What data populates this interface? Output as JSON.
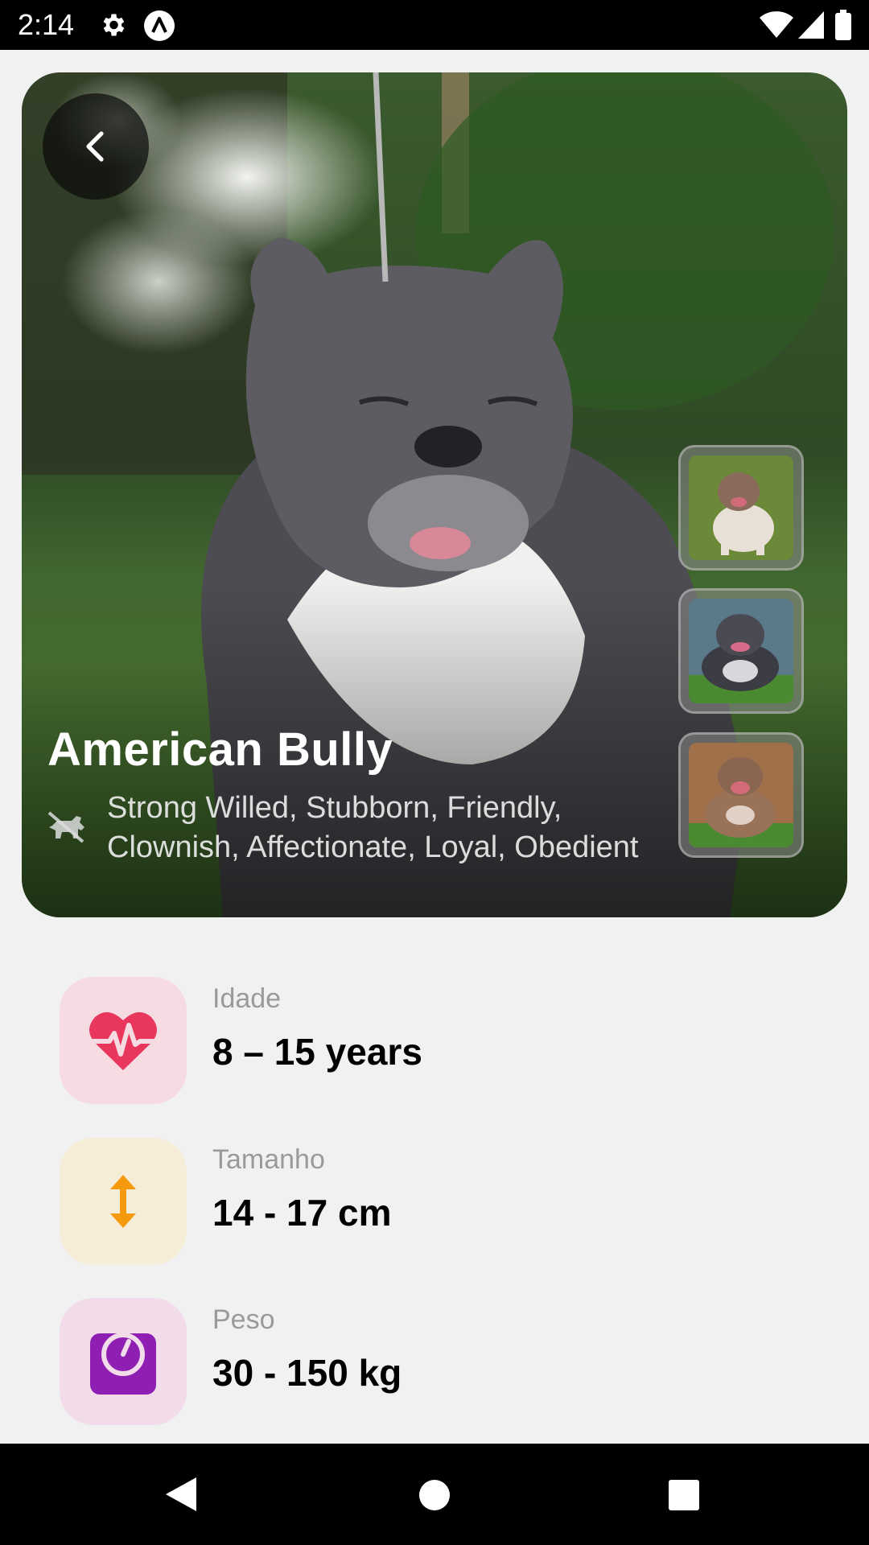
{
  "status_bar": {
    "time": "2:14",
    "icons": [
      "gear-icon",
      "app-a-icon",
      "wifi-icon",
      "signal-icon",
      "battery-icon"
    ]
  },
  "hero": {
    "title": "American Bully",
    "temperament": "Strong Willed, Stubborn, Friendly, Clownish, Affectionate, Loyal, Obedient",
    "back_icon": "chevron-left-icon",
    "temperament_icon": "dog-icon",
    "thumbnails": [
      "thumbnail-1",
      "thumbnail-2",
      "thumbnail-3"
    ]
  },
  "stats": [
    {
      "label": "Idade",
      "value": "8 – 15 years",
      "icon": "heartbeat-icon",
      "icon_color": "#e8365d",
      "bg_color": "#f6dbe2"
    },
    {
      "label": "Tamanho",
      "value": "14 - 17 cm",
      "icon": "vertical-arrows-icon",
      "icon_color": "#f59a0f",
      "bg_color": "#f6edd8"
    },
    {
      "label": "Peso",
      "value": "30 - 150 kg",
      "icon": "scale-icon",
      "icon_color": "#8f1fb3",
      "bg_color": "#f2dcea"
    }
  ],
  "nav_bar": {
    "icons": [
      "back-triangle-icon",
      "home-circle-icon",
      "recents-square-icon"
    ]
  }
}
